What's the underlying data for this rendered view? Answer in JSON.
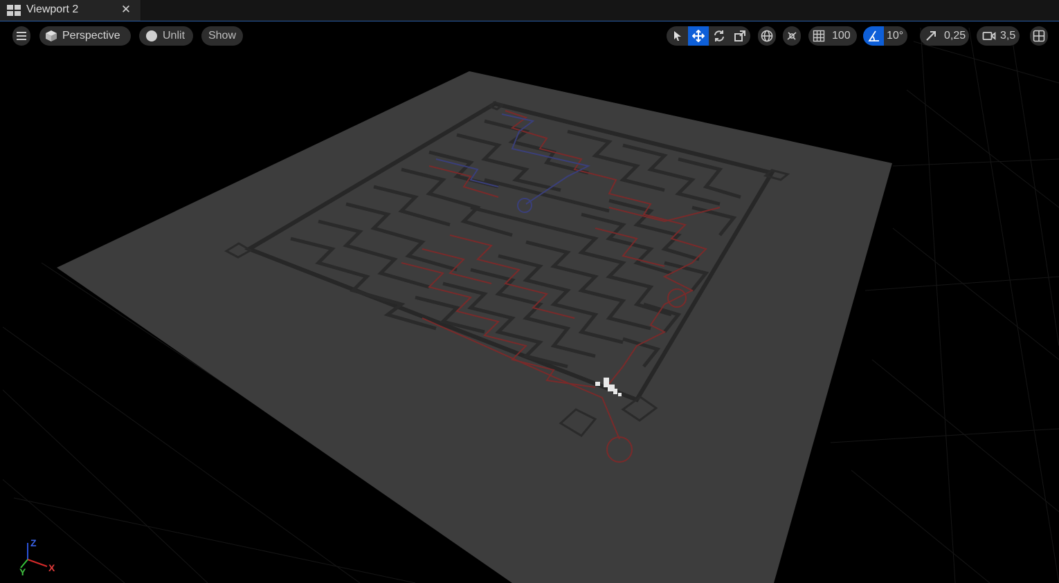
{
  "tab": {
    "title": "Viewport 2",
    "icon": "viewport-layout-icon",
    "close_icon": "close-icon",
    "close_glyph": "✕"
  },
  "toolbar": {
    "menu_icon": "hamburger-menu-icon",
    "view_mode": {
      "label": "Perspective",
      "icon": "cube-icon"
    },
    "lighting": {
      "label": "Unlit",
      "icon": "sphere-icon"
    },
    "show": {
      "label": "Show"
    },
    "transform_tools": [
      {
        "name": "select",
        "icon": "select-arrow-icon",
        "active": false
      },
      {
        "name": "translate",
        "icon": "move-icon",
        "active": true
      },
      {
        "name": "rotate",
        "icon": "rotate-icon",
        "active": false
      },
      {
        "name": "scale",
        "icon": "scale-icon",
        "active": false
      }
    ],
    "world_space_icon": "globe-icon",
    "surface_snap_icon": "surface-snap-icon",
    "grid_snap": {
      "icon": "grid-icon",
      "value": "100",
      "active": false
    },
    "rotation_snap": {
      "icon": "angle-icon",
      "value": "10°",
      "active": true
    },
    "scale_snap": {
      "icon": "scale-arrow-icon",
      "value": "0,25"
    },
    "camera_speed": {
      "icon": "camera-icon",
      "value": "3,5"
    },
    "layout_icon": "viewport-layout-icon"
  },
  "gizmo": {
    "z": "Z",
    "x": "X",
    "y": "Y"
  },
  "colors": {
    "accent": "#0e5fd8",
    "floor": "#3c3c3c",
    "maze_wall": "#2a2a2a",
    "path_red": "#7a2a2a",
    "path_blue": "#3a3f7a"
  }
}
